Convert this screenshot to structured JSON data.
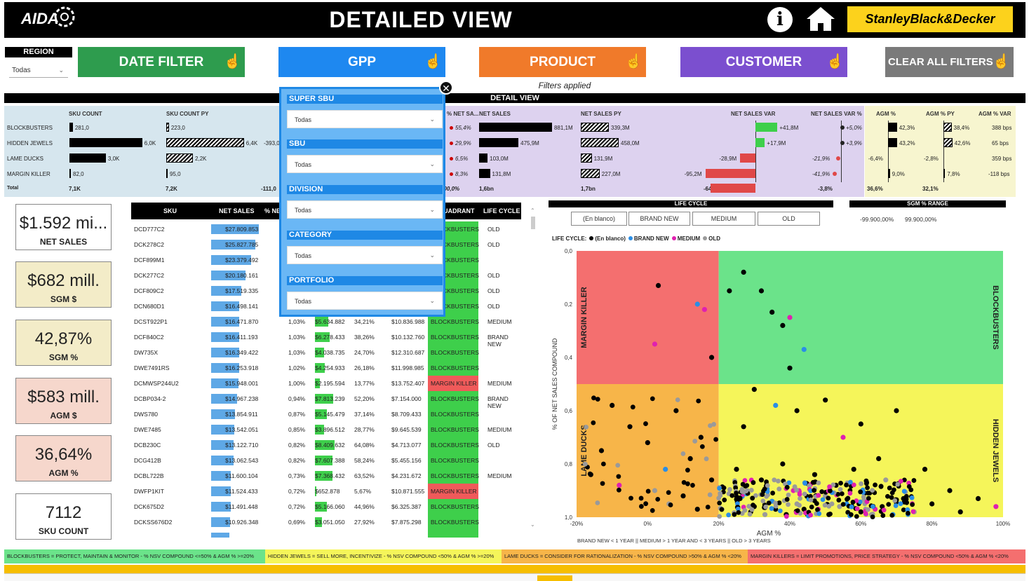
{
  "header": {
    "logo": "AIDA",
    "title": "DETAILED VIEW",
    "brand": "StanleyBlack&Decker"
  },
  "region": {
    "label": "REGION",
    "value": "Todas"
  },
  "filter_buttons": [
    {
      "label": "DATE FILTER",
      "color": "#2e9c4e"
    },
    {
      "label": "GPP",
      "color": "#1e88f0"
    },
    {
      "label": "PRODUCT",
      "color": "#f07a2a"
    },
    {
      "label": "CUSTOMER",
      "color": "#7b4fcf"
    },
    {
      "label": "CLEAR ALL FILTERS",
      "color": "#7a7a7a"
    }
  ],
  "filters_applied": "Filters applied",
  "detail_view": "DETAIL VIEW",
  "kpi_headers": [
    "SKU COUNT",
    "SKU COUNT PY",
    "% NET SA...",
    "NET SALES",
    "NET SALES PY",
    "NET SALES VAR",
    "NET SALES VAR %",
    "AGM %",
    "AGM % PY",
    "AGM % VAR"
  ],
  "kpi_rows": [
    "BLOCKBUSTERS",
    "HIDDEN JEWELS",
    "LAME DUCKS",
    "MARGIN KILLER",
    "Total"
  ],
  "kpi_values": {
    "sku_count": [
      "281,0",
      "6,0K",
      "3,0K",
      "82,0",
      "7,1K"
    ],
    "sku_count_py": [
      "223,0",
      "6,4K",
      "2,2K",
      "95,0",
      "7,2K"
    ],
    "sku_var_partial": [
      "-393,0",
      "-111,0"
    ],
    "pct_net_sales": [
      "55,4%",
      "29,9%",
      "6,5%",
      "8,3%",
      "100,0%"
    ],
    "net_sales": [
      "881,1M",
      "475,9M",
      "103,0M",
      "131,8M",
      "1,6bn"
    ],
    "net_sales_py": [
      "339,3M",
      "458,0M",
      "131,9M",
      "227,0M",
      "1,7bn"
    ],
    "net_sales_var": [
      "+41,8M",
      "+17,9M",
      "-28,9M",
      "-95,2M",
      "-64,4M"
    ],
    "net_sales_var_pct": [
      "+5,0%",
      "+3,9%",
      "-21,9%",
      "-41,9%",
      "-3,8%"
    ],
    "agm_pct": [
      "42,3%",
      "43,2%",
      "-6,4%",
      "9,0%",
      "36,6%"
    ],
    "agm_pct_py": [
      "38,4%",
      "42,6%",
      "-2,8%",
      "7,8%",
      "32,1%"
    ],
    "agm_pct_var": [
      "388 bps",
      "65 bps",
      "359 bps",
      "-118 bps"
    ]
  },
  "cards": [
    {
      "value": "$1.592 mi...",
      "label": "NET SALES",
      "bg": "#ffffff"
    },
    {
      "value": "$682 mill.",
      "label": "SGM $",
      "bg": "#f3ecc8"
    },
    {
      "value": "42,87%",
      "label": "SGM %",
      "bg": "#f3ecc8"
    },
    {
      "value": "$583 mill.",
      "label": "AGM $",
      "bg": "#f6d7cc"
    },
    {
      "value": "36,64%",
      "label": "AGM %",
      "bg": "#f6d7cc"
    },
    {
      "value": "7112",
      "label": "SKU COUNT",
      "bg": "#ffffff"
    }
  ],
  "table": {
    "headers": [
      "SKU",
      "NET SALES",
      "% NET",
      "QUADRANT",
      "LIFE CYCLE"
    ],
    "rows": [
      [
        "DCD777C2",
        "$27.809.853",
        "",
        "",
        "",
        "",
        "BLOCKBUSTERS",
        "OLD"
      ],
      [
        "DCK278C2",
        "$25.827.785",
        "",
        "",
        "",
        "",
        "BLOCKBUSTERS",
        "OLD"
      ],
      [
        "DCF899M1",
        "$23.379.492",
        "",
        "",
        "",
        "",
        "BLOCKBUSTERS",
        ""
      ],
      [
        "DCK277C2",
        "$20.180.161",
        "",
        "",
        "",
        "",
        "BLOCKBUSTERS",
        "OLD"
      ],
      [
        "DCF809C2",
        "$17.519.335",
        "",
        "",
        "",
        "",
        "BLOCKBUSTERS",
        "OLD"
      ],
      [
        "DCN680D1",
        "$16.498.141",
        "",
        "",
        "",
        "",
        "BLOCKBUSTERS",
        "OLD"
      ],
      [
        "DCST922P1",
        "$16.471.870",
        "1,03%",
        "$5.634.882",
        "34,21%",
        "$10.836.988",
        "BLOCKBUSTERS",
        "MEDIUM"
      ],
      [
        "DCF840C2",
        "$16.411.193",
        "1,03%",
        "$6.278.433",
        "38,26%",
        "$10.132.760",
        "BLOCKBUSTERS",
        "BRAND NEW"
      ],
      [
        "DW735X",
        "$16.349.422",
        "1,03%",
        "$4.038.735",
        "24,70%",
        "$12.310.687",
        "BLOCKBUSTERS",
        ""
      ],
      [
        "DWE7491RS",
        "$16.253.918",
        "1,02%",
        "$4.254.933",
        "26,18%",
        "$11.998.985",
        "BLOCKBUSTERS",
        ""
      ],
      [
        "DCMWSP244U2",
        "$15.948.001",
        "1,00%",
        "$2.195.594",
        "13,77%",
        "$13.752.407",
        "MARGIN KILLER",
        "MEDIUM"
      ],
      [
        "DCBP034-2",
        "$14.967.238",
        "0,94%",
        "$7.813.239",
        "52,20%",
        "$7.154.000",
        "BLOCKBUSTERS",
        "BRAND NEW"
      ],
      [
        "DWS780",
        "$13.854.911",
        "0,87%",
        "$5.145.479",
        "37,14%",
        "$8.709.433",
        "BLOCKBUSTERS",
        ""
      ],
      [
        "DWE7485",
        "$13.542.051",
        "0,85%",
        "$3.896.512",
        "28,77%",
        "$9.645.539",
        "BLOCKBUSTERS",
        "MEDIUM"
      ],
      [
        "DCB230C",
        "$13.122.710",
        "0,82%",
        "$8.409.632",
        "64,08%",
        "$4.713.077",
        "BLOCKBUSTERS",
        "OLD"
      ],
      [
        "DCG412B",
        "$13.062.543",
        "0,82%",
        "$7.607.388",
        "58,24%",
        "$5.455.156",
        "BLOCKBUSTERS",
        ""
      ],
      [
        "DCBL722B",
        "$11.600.104",
        "0,73%",
        "$7.368.432",
        "63,52%",
        "$4.231.672",
        "BLOCKBUSTERS",
        "MEDIUM"
      ],
      [
        "DWFP1KIT",
        "$11.524.433",
        "0,72%",
        "$652.878",
        "5,67%",
        "$10.871.555",
        "MARGIN KILLER",
        ""
      ],
      [
        "DCK675D2",
        "$11.491.448",
        "0,72%",
        "$5.166.060",
        "44,96%",
        "$6.325.387",
        "BLOCKBUSTERS",
        ""
      ],
      [
        "DCKSS676D2",
        "$10.926.348",
        "0,69%",
        "$3.051.050",
        "27,92%",
        "$7.875.298",
        "BLOCKBUSTERS",
        ""
      ]
    ]
  },
  "popup": {
    "fields": [
      {
        "label": "SUPER SBU",
        "value": "Todas"
      },
      {
        "label": "SBU",
        "value": "Todas"
      },
      {
        "label": "DIVISION",
        "value": "Todas"
      },
      {
        "label": "CATEGORY",
        "value": "Todas"
      },
      {
        "label": "PORTFOLIO",
        "value": "Todas"
      }
    ]
  },
  "lifecycle": {
    "title": "LIFE CYCLE",
    "options": [
      "(En blanco)",
      "BRAND NEW",
      "MEDIUM",
      "OLD"
    ]
  },
  "sgm_range": {
    "title": "SGM % RANGE",
    "min": "-99.900,00%",
    "max": "99.900,00%"
  },
  "scatter_legend": {
    "prefix": "LIFE CYCLE:",
    "items": [
      {
        "name": "(En blanco)",
        "color": "#000000"
      },
      {
        "name": "BRAND NEW",
        "color": "#2a8ee6"
      },
      {
        "name": "MEDIUM",
        "color": "#e020b0"
      },
      {
        "name": "OLD",
        "color": "#9a9a9a"
      }
    ]
  },
  "chart_data": {
    "type": "scatter",
    "xlabel": "AGM %",
    "ylabel": "% OF NET SALES COMPOUND",
    "xticks": [
      "-20%",
      "0%",
      "20%",
      "40%",
      "60%",
      "80%",
      "100%"
    ],
    "yticks": [
      "0,0",
      "0,2",
      "0,4",
      "0,6",
      "0,8",
      "1,0"
    ],
    "xlim": [
      -20,
      100
    ],
    "ylim": [
      0,
      1
    ],
    "quadrants": [
      {
        "name": "MARGIN KILLER",
        "color": "#f46f6f"
      },
      {
        "name": "BLOCKBUSTERS",
        "color": "#6be38a"
      },
      {
        "name": "LAME DUCKS",
        "color": "#f7b549"
      },
      {
        "name": "HIDDEN JEWELS",
        "color": "#f5f55a"
      }
    ],
    "points": [
      {
        "x": -16,
        "y": 0.84,
        "c": "black"
      },
      {
        "x": -10,
        "y": 0.58,
        "c": "black"
      },
      {
        "x": 3,
        "y": 0.13,
        "c": "black"
      },
      {
        "x": 2,
        "y": 0.35,
        "c": "magenta"
      },
      {
        "x": 14,
        "y": 0.2,
        "c": "blue"
      },
      {
        "x": 16,
        "y": 0.22,
        "c": "magenta"
      },
      {
        "x": 18,
        "y": 0.4,
        "c": "black"
      },
      {
        "x": 23,
        "y": 0.15,
        "c": "black"
      },
      {
        "x": 27,
        "y": 0.08,
        "c": "black"
      },
      {
        "x": 35,
        "y": 0.23,
        "c": "black"
      },
      {
        "x": 38,
        "y": 0.28,
        "c": "black"
      },
      {
        "x": 40,
        "y": 0.25,
        "c": "magenta"
      },
      {
        "x": 44,
        "y": 0.37,
        "c": "blue"
      },
      {
        "x": 40,
        "y": 0.44,
        "c": "black"
      },
      {
        "x": 32,
        "y": 0.15,
        "c": "black"
      },
      {
        "x": -5,
        "y": 0.66,
        "c": "black"
      },
      {
        "x": 0,
        "y": 0.72,
        "c": "black"
      },
      {
        "x": 8,
        "y": 0.6,
        "c": "black"
      },
      {
        "x": 12,
        "y": 0.78,
        "c": "black"
      },
      {
        "x": 15,
        "y": 0.7,
        "c": "black"
      },
      {
        "x": -8,
        "y": 0.88,
        "c": "magenta"
      },
      {
        "x": 2,
        "y": 0.9,
        "c": "gray"
      },
      {
        "x": 5,
        "y": 0.82,
        "c": "blue"
      },
      {
        "x": 10,
        "y": 0.92,
        "c": "black"
      },
      {
        "x": 18,
        "y": 0.86,
        "c": "black"
      },
      {
        "x": -13,
        "y": 0.75,
        "c": "black"
      },
      {
        "x": 6,
        "y": 0.95,
        "c": "gray"
      },
      {
        "x": 14,
        "y": 0.97,
        "c": "black"
      },
      {
        "x": 27,
        "y": 0.66,
        "c": "black"
      },
      {
        "x": 30,
        "y": 0.52,
        "c": "black"
      },
      {
        "x": 36,
        "y": 0.58,
        "c": "blue"
      },
      {
        "x": 42,
        "y": 0.6,
        "c": "black"
      },
      {
        "x": 50,
        "y": 0.56,
        "c": "black"
      },
      {
        "x": 55,
        "y": 0.7,
        "c": "magenta"
      },
      {
        "x": 60,
        "y": 0.65,
        "c": "black"
      },
      {
        "x": 65,
        "y": 0.78,
        "c": "black"
      },
      {
        "x": 70,
        "y": 0.6,
        "c": "black"
      },
      {
        "x": 78,
        "y": 0.82,
        "c": "black"
      },
      {
        "x": 85,
        "y": 0.9,
        "c": "black"
      },
      {
        "x": 93,
        "y": 0.93,
        "c": "black"
      },
      {
        "x": 98,
        "y": 0.96,
        "c": "magenta"
      },
      {
        "x": 25,
        "y": 0.82,
        "c": "black"
      },
      {
        "x": 28,
        "y": 0.9,
        "c": "gray"
      },
      {
        "x": 32,
        "y": 0.86,
        "c": "black"
      },
      {
        "x": 35,
        "y": 0.94,
        "c": "blue"
      },
      {
        "x": 38,
        "y": 0.8,
        "c": "black"
      },
      {
        "x": 41,
        "y": 0.9,
        "c": "magenta"
      },
      {
        "x": 44,
        "y": 0.97,
        "c": "black"
      },
      {
        "x": 47,
        "y": 0.84,
        "c": "black"
      },
      {
        "x": 50,
        "y": 0.92,
        "c": "gray"
      },
      {
        "x": 53,
        "y": 0.88,
        "c": "black"
      },
      {
        "x": 56,
        "y": 0.95,
        "c": "blue"
      },
      {
        "x": 58,
        "y": 0.82,
        "c": "black"
      },
      {
        "x": 61,
        "y": 0.91,
        "c": "black"
      },
      {
        "x": 64,
        "y": 0.97,
        "c": "magenta"
      },
      {
        "x": 67,
        "y": 0.86,
        "c": "gray"
      },
      {
        "x": 72,
        "y": 0.93,
        "c": "black"
      },
      {
        "x": 75,
        "y": 0.98,
        "c": "gray"
      },
      {
        "x": 80,
        "y": 0.95,
        "c": "black"
      },
      {
        "x": 88,
        "y": 0.98,
        "c": "black"
      },
      {
        "x": 30,
        "y": 0.96,
        "c": "black"
      },
      {
        "x": 33,
        "y": 0.99,
        "c": "gray"
      },
      {
        "x": 36,
        "y": 0.97,
        "c": "black"
      },
      {
        "x": 39,
        "y": 0.99,
        "c": "black"
      },
      {
        "x": 42,
        "y": 0.95,
        "c": "gray"
      },
      {
        "x": 45,
        "y": 0.99,
        "c": "black"
      },
      {
        "x": 48,
        "y": 0.97,
        "c": "magenta"
      },
      {
        "x": 51,
        "y": 0.99,
        "c": "black"
      },
      {
        "x": 54,
        "y": 0.96,
        "c": "gray"
      },
      {
        "x": 57,
        "y": 0.99,
        "c": "black"
      },
      {
        "x": 60,
        "y": 0.98,
        "c": "black"
      },
      {
        "x": 63,
        "y": 0.99,
        "c": "gray"
      },
      {
        "x": 66,
        "y": 0.96,
        "c": "black"
      },
      {
        "x": 69,
        "y": 0.99,
        "c": "blue"
      },
      {
        "x": 26,
        "y": 0.93,
        "c": "black"
      },
      {
        "x": 29,
        "y": 0.98,
        "c": "black"
      }
    ]
  },
  "axis_note": "BRAND NEW < 1 YEAR || MEDIUM > 1 YEAR AND < 3 YEARS || OLD > 3 YEARS",
  "bottom_legend": [
    {
      "text": "BLOCKBUSTERS = PROTECT, MAINTAIN & MONITOR - % NSV COMPOUND <=50% & AGM % >=20%",
      "color": "#6be38a"
    },
    {
      "text": "HIDDEN JEWELS = SELL MORE, INCENTIVIZE - % NSV COMPOUND <50% & AGM % >=20%",
      "color": "#f5f55a"
    },
    {
      "text": "LAME DUCKS = CONSIDER FOR RATIONALIZATION - % NSV COMPOUND >50% & AGM % <20%",
      "color": "#f7b549"
    },
    {
      "text": "MARGIN KILLERS = LIMIT PROMOTIONS, PRICE STRATEGY - % NSV COMPOUND <50% & AGM % <20%",
      "color": "#f46f6f"
    }
  ]
}
